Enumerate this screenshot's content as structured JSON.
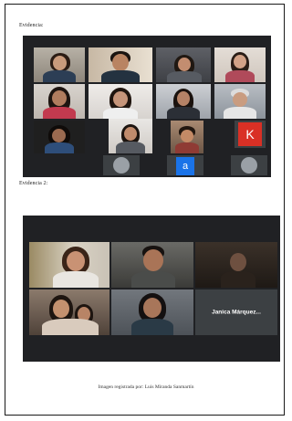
{
  "captions": {
    "evidence1": "Evidencia:",
    "evidence2": "Evidencia 2:"
  },
  "footer": "Imagen registrada por: Luis Miranda Sanmartín",
  "meeting1": {
    "tiles": [
      {
        "kind": "video"
      },
      {
        "kind": "video"
      },
      {
        "kind": "video"
      },
      {
        "kind": "video"
      },
      {
        "kind": "video"
      },
      {
        "kind": "video"
      },
      {
        "kind": "video"
      },
      {
        "kind": "video"
      },
      {
        "kind": "video"
      },
      {
        "kind": "video"
      },
      {
        "kind": "video"
      },
      {
        "kind": "avatar",
        "letter": "K",
        "color": "#d93025"
      },
      {
        "kind": "avatar",
        "letter": "",
        "color": "#9aa0a6"
      },
      {
        "kind": "avatar",
        "letter": "a",
        "color": "#1a73e8"
      },
      {
        "kind": "avatar",
        "letter": "",
        "color": "#9aa0a6"
      }
    ]
  },
  "meeting2": {
    "participant_name": "Janica Márquez..."
  },
  "colors": {
    "meeting_bg": "#202124",
    "tile_bg": "#3c4043",
    "active_speaker": "#c9d46a"
  }
}
